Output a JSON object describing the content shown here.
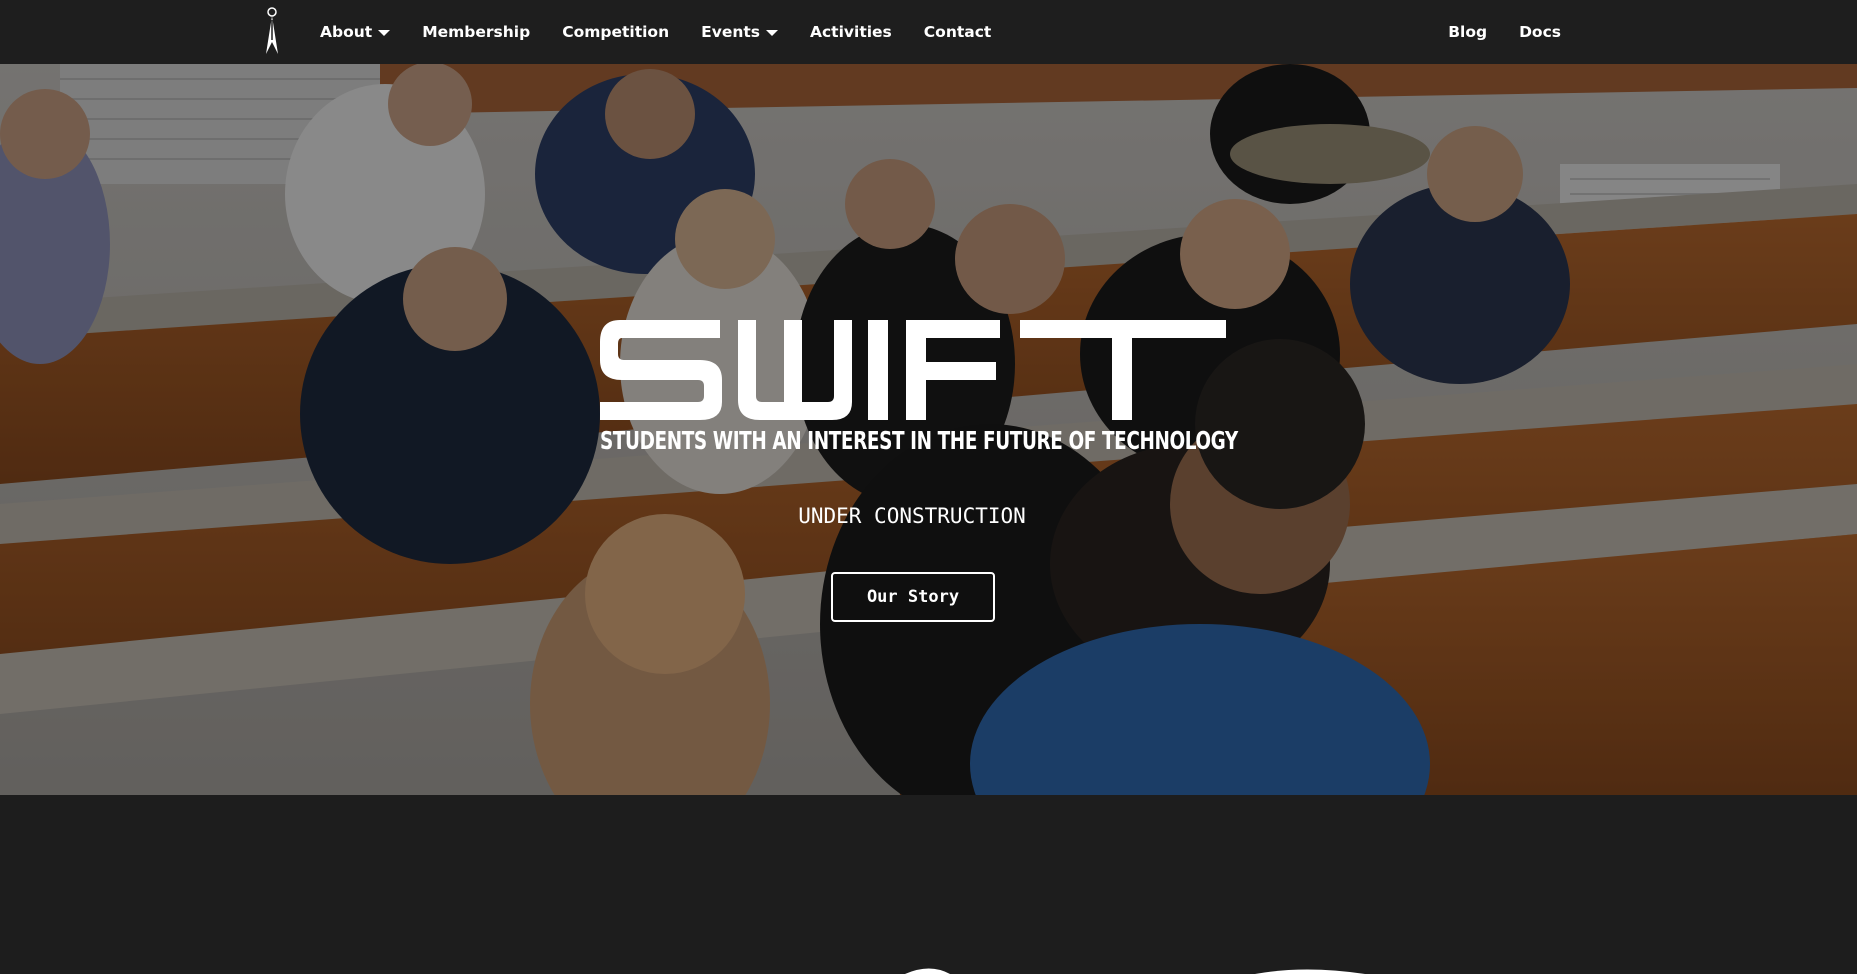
{
  "navbar": {
    "logo_icon": "pen-nib-icon",
    "left_items": [
      {
        "label": "About",
        "dropdown": true
      },
      {
        "label": "Membership",
        "dropdown": false
      },
      {
        "label": "Competition",
        "dropdown": false
      },
      {
        "label": "Events",
        "dropdown": true
      },
      {
        "label": "Activities",
        "dropdown": false
      },
      {
        "label": "Contact",
        "dropdown": false
      }
    ],
    "right_items": [
      {
        "label": "Blog"
      },
      {
        "label": "Docs"
      }
    ]
  },
  "hero": {
    "wordmark": "SWIFT",
    "tagline": "STUDENTS WITH AN INTEREST IN THE FUTURE OF TECHNOLOGY",
    "status": "UNDER CONSTRUCTION",
    "cta_label": "Our Story"
  },
  "colors": {
    "navbar_bg": "#1e1e1e",
    "page_bg": "#1d1d1d",
    "text": "#ffffff"
  }
}
